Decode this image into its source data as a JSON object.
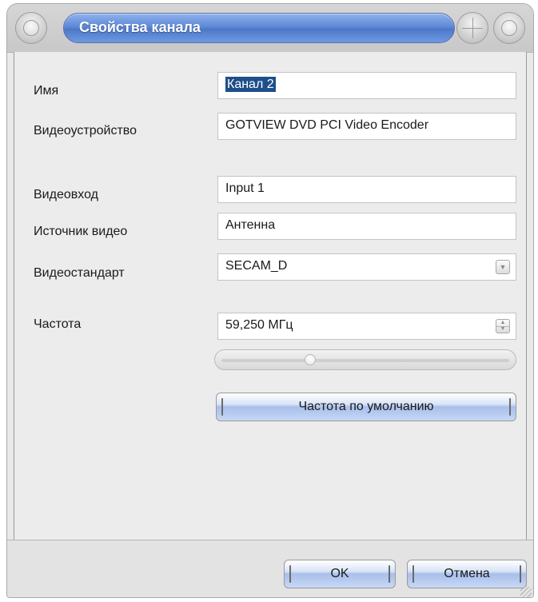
{
  "window": {
    "title": "Свойства канала"
  },
  "form": {
    "name": {
      "label": "Имя",
      "value": "Канал 2"
    },
    "device": {
      "label": "Видеоустройство",
      "value": "GOTVIEW DVD PCI Video Encoder"
    },
    "input": {
      "label": "Видеовход",
      "value": "Input 1"
    },
    "source": {
      "label": "Источник видео",
      "value": "Антенна"
    },
    "standard": {
      "label": "Видеостандарт",
      "value": "SECAM_D"
    },
    "frequency": {
      "label": "Частота",
      "value": "59,250 МГц",
      "slider_fraction": 0.3
    },
    "default_freq_button": "Частота по умолчанию"
  },
  "footer": {
    "ok_label": "OK",
    "cancel_label": "Отмена"
  },
  "colors": {
    "title_accent": "#5f89d6",
    "selection": "#1f4f8a"
  }
}
